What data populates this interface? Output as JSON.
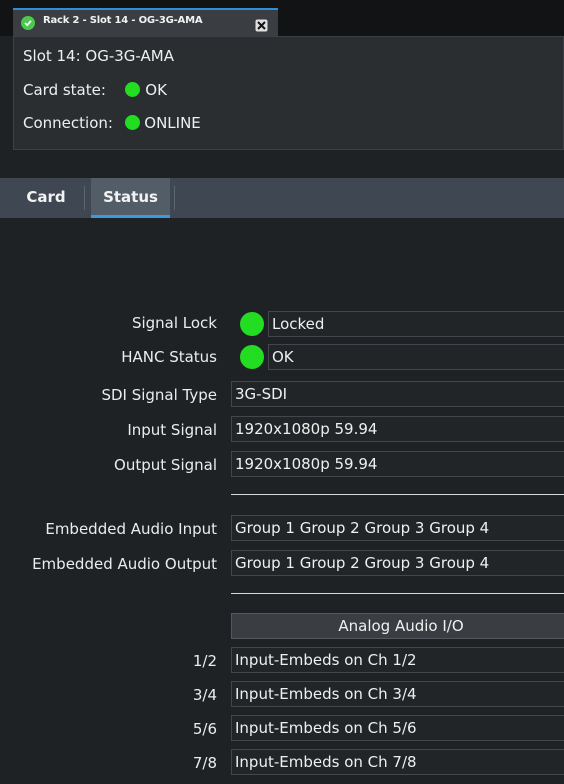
{
  "window": {
    "tab_title": "Rack 2 - Slot 14 - OG-3G-AMA"
  },
  "info": {
    "slot": "Slot 14: OG-3G-AMA",
    "card_state_label": "Card state:",
    "card_state_value": "OK",
    "connection_label": "Connection:",
    "connection_value": "ONLINE",
    "status_color": "#22dd22"
  },
  "tabs": [
    {
      "label": "Card",
      "active": false
    },
    {
      "label": "Status",
      "active": true
    }
  ],
  "status": {
    "signal_lock": {
      "label": "Signal Lock",
      "value": "Locked"
    },
    "hanc_status": {
      "label": "HANC Status",
      "value": "OK"
    },
    "sdi_signal_type": {
      "label": "SDI Signal Type",
      "value": "3G-SDI"
    },
    "input_signal": {
      "label": "Input Signal",
      "value": "1920x1080p 59.94"
    },
    "output_signal": {
      "label": "Output Signal",
      "value": "1920x1080p 59.94"
    },
    "embedded_audio_input": {
      "label": "Embedded Audio Input",
      "value": "Group 1 Group 2 Group 3 Group 4"
    },
    "embedded_audio_output": {
      "label": "Embedded Audio Output",
      "value": "Group 1 Group 2 Group 3 Group 4"
    },
    "analog_header": "Analog Audio I/O",
    "analog_rows": [
      {
        "label": "1/2",
        "value": "Input-Embeds on Ch 1/2"
      },
      {
        "label": "3/4",
        "value": "Input-Embeds on Ch 3/4"
      },
      {
        "label": "5/6",
        "value": "Input-Embeds on Ch 5/6"
      },
      {
        "label": "7/8",
        "value": "Input-Embeds on Ch 7/8"
      }
    ]
  }
}
